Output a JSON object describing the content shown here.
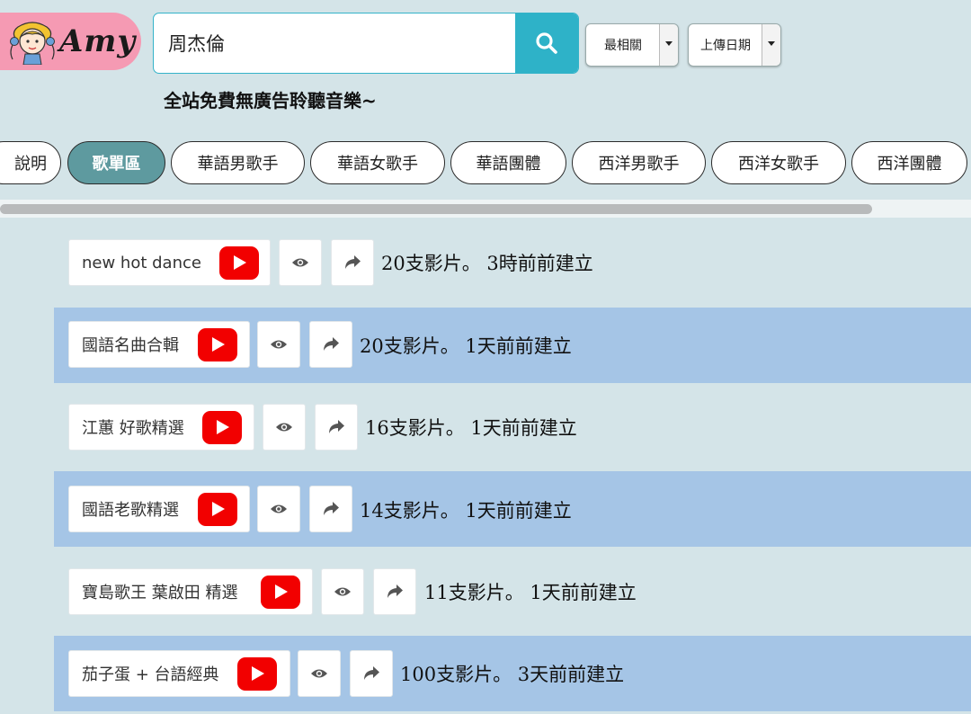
{
  "header": {
    "logo_text": "Amy",
    "search_value": "周杰倫",
    "sort_select": "最相關",
    "date_select": "上傳日期",
    "tagline": "全站免費無廣告聆聽音樂~"
  },
  "tabs": [
    "說明",
    "歌單區",
    "華語男歌手",
    "華語女歌手",
    "華語團體",
    "西洋男歌手",
    "西洋女歌手",
    "西洋團體"
  ],
  "active_tab": "歌單區",
  "playlists": [
    {
      "title": "new hot dance",
      "meta": "20支影片。 3時前前建立"
    },
    {
      "title": "國語名曲合輯",
      "meta": "20支影片。 1天前前建立"
    },
    {
      "title": "江蕙 好歌精選",
      "meta": "16支影片。 1天前前建立"
    },
    {
      "title": "國語老歌精選",
      "meta": "14支影片。 1天前前建立"
    },
    {
      "title": "寶島歌王 葉啟田 精選",
      "meta": "11支影片。 1天前前建立"
    },
    {
      "title": "茄子蛋 + 台語經典",
      "meta": "100支影片。 3天前前建立"
    }
  ],
  "icons": {
    "search": "search-icon",
    "play": "youtube-play-icon",
    "view": "eye-icon",
    "share": "share-icon"
  },
  "colors": {
    "background": "#d4e4e8",
    "accent": "#2eb2c8",
    "logo_bg": "#f59ab3",
    "active_tab": "#5e9a9f",
    "band": "#a5c5e6",
    "youtube": "#f20000"
  }
}
